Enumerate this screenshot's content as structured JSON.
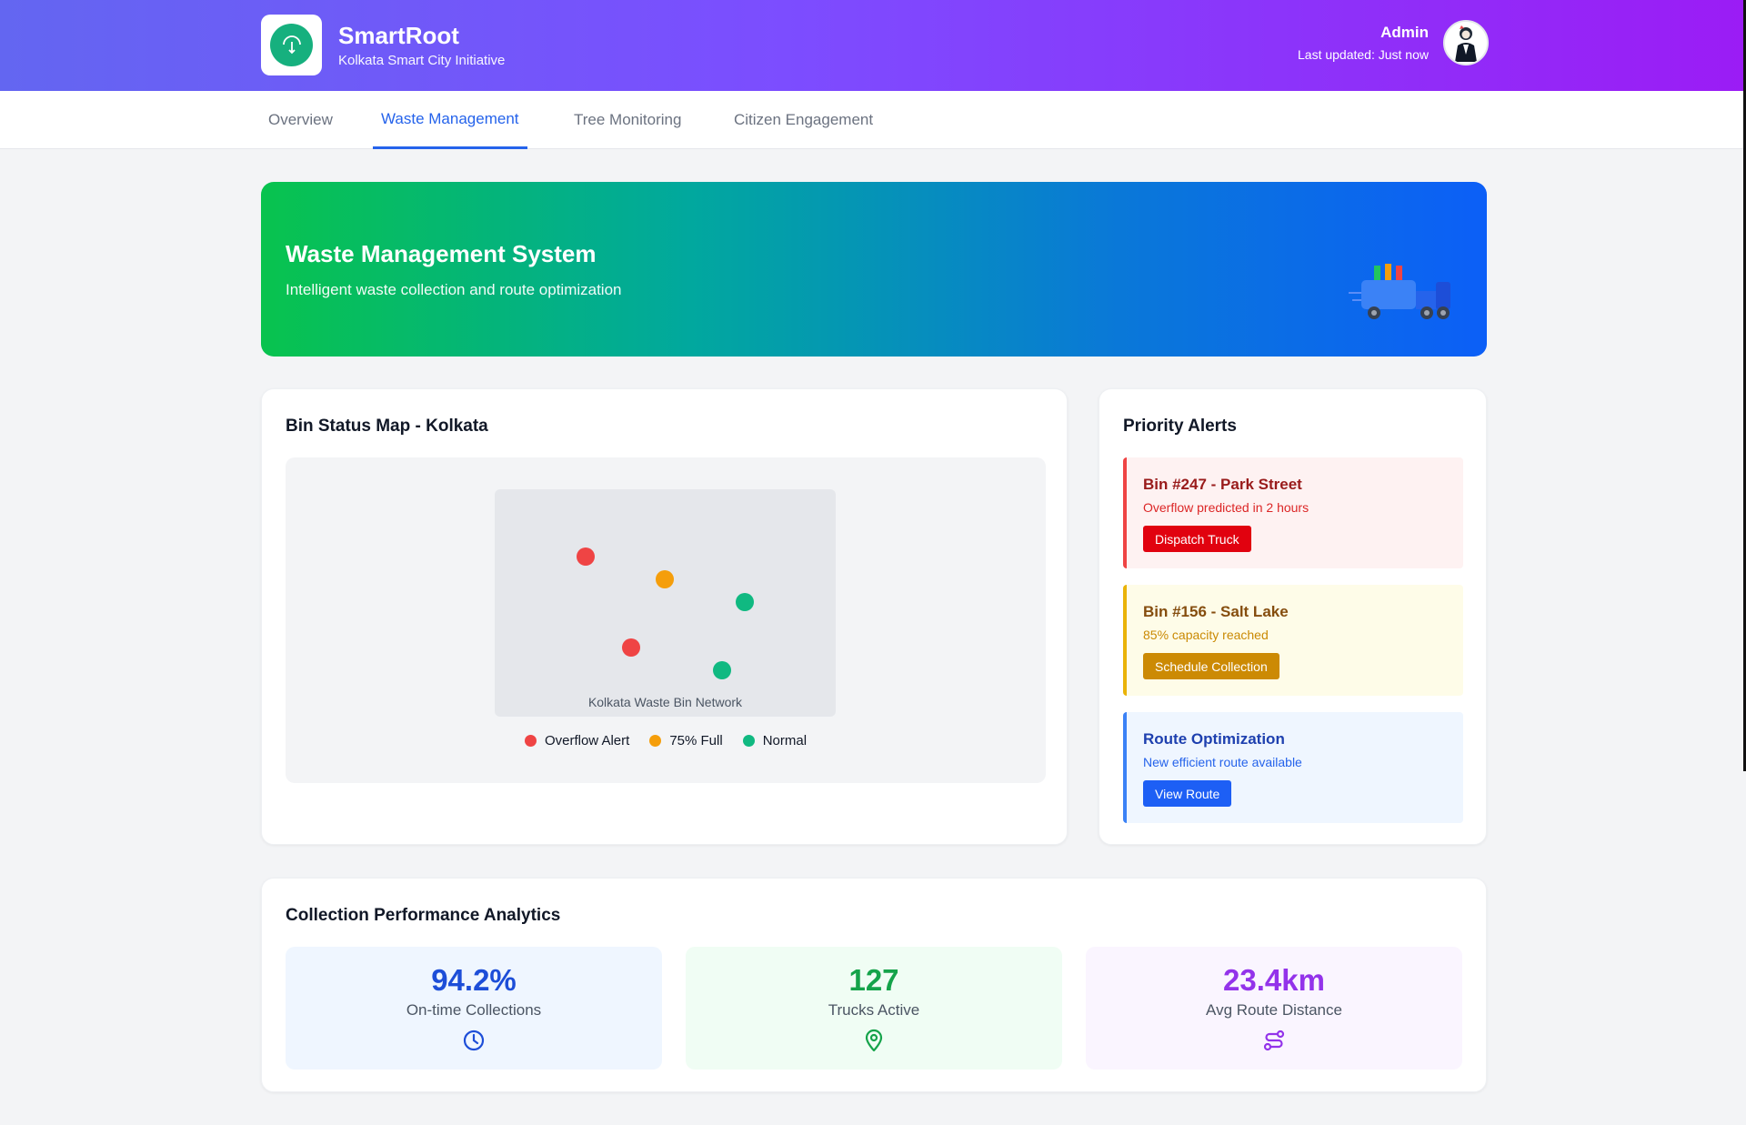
{
  "header": {
    "app_name": "SmartRoot",
    "app_subtitle": "Kolkata Smart City Initiative",
    "user_name": "Admin",
    "last_updated": "Last updated: Just now"
  },
  "nav": {
    "tabs": [
      {
        "label": "Overview",
        "active": false
      },
      {
        "label": "Waste Management",
        "active": true
      },
      {
        "label": "Tree Monitoring",
        "active": false
      },
      {
        "label": "Citizen Engagement",
        "active": false
      }
    ]
  },
  "hero": {
    "title": "Waste Management System",
    "subtitle": "Intelligent waste collection and route optimization"
  },
  "map": {
    "title": "Bin Status Map - Kolkata",
    "caption": "Kolkata Waste Bin Network",
    "legend": [
      {
        "label": "Overflow Alert",
        "color": "#ef4444"
      },
      {
        "label": "75% Full",
        "color": "#f59e0b"
      },
      {
        "label": "Normal",
        "color": "#10b981"
      }
    ],
    "bins": [
      {
        "status": "overflow"
      },
      {
        "status": "75% full"
      },
      {
        "status": "normal"
      },
      {
        "status": "overflow"
      },
      {
        "status": "normal"
      }
    ]
  },
  "alerts": {
    "title": "Priority Alerts",
    "items": [
      {
        "title": "Bin #247 - Park Street",
        "description": "Overflow predicted in 2 hours",
        "action": "Dispatch Truck",
        "severity": "critical"
      },
      {
        "title": "Bin #156 - Salt Lake",
        "description": "85% capacity reached",
        "action": "Schedule Collection",
        "severity": "warning"
      },
      {
        "title": "Route Optimization",
        "description": "New efficient route available",
        "action": "View Route",
        "severity": "info"
      }
    ]
  },
  "performance": {
    "title": "Collection Performance Analytics",
    "stats": [
      {
        "value": "94.2%",
        "label": "On-time Collections",
        "icon": "clock-icon"
      },
      {
        "value": "127",
        "label": "Trucks Active",
        "icon": "map-pin-icon"
      },
      {
        "value": "23.4km",
        "label": "Avg Route Distance",
        "icon": "route-icon"
      }
    ]
  },
  "colors": {
    "header_gradient_start": "#6366f1",
    "header_gradient_end": "#9b1cf5",
    "accent": "#2563eb",
    "hero_gradient_start": "#08c34e",
    "hero_gradient_end": "#0c5ff7"
  }
}
